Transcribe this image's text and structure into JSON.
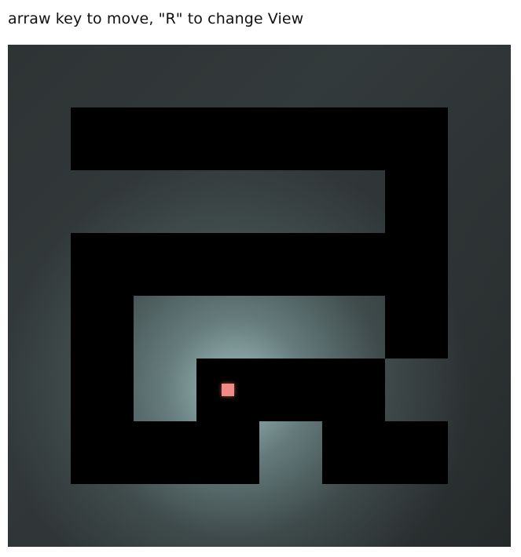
{
  "instructions": "arraw key to move, \"R\" to change View",
  "colors": {
    "wall": "#000000",
    "player": "#f08a85",
    "floor_dark": "#2e3334",
    "light": "#a5c3c3"
  },
  "maze": {
    "cols": 8,
    "rows": 8,
    "walls": [
      [
        1,
        1
      ],
      [
        2,
        1
      ],
      [
        3,
        1
      ],
      [
        4,
        1
      ],
      [
        5,
        1
      ],
      [
        6,
        1
      ],
      [
        6,
        2
      ],
      [
        1,
        3
      ],
      [
        2,
        3
      ],
      [
        3,
        3
      ],
      [
        4,
        3
      ],
      [
        5,
        3
      ],
      [
        6,
        3
      ],
      [
        1,
        4
      ],
      [
        6,
        4
      ],
      [
        1,
        5
      ],
      [
        3,
        5
      ],
      [
        4,
        5
      ],
      [
        5,
        5
      ],
      [
        1,
        6
      ],
      [
        2,
        6
      ],
      [
        3,
        6
      ],
      [
        5,
        6
      ],
      [
        6,
        6
      ]
    ]
  },
  "player": {
    "col": 3,
    "row": 5
  }
}
